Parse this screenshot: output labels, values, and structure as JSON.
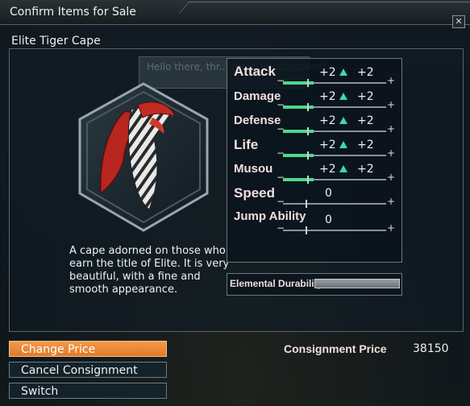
{
  "window": {
    "title": "Confirm Items for Sale",
    "close_label": "✕"
  },
  "item": {
    "name": "Elite Tiger Cape",
    "description": "A cape adorned on those who earn the title of Elite. It is very beautiful, with a fine and smooth appearance."
  },
  "background_dialog": {
    "text": "Hello there, thr... (partially obscured)"
  },
  "stats": [
    {
      "label": "Attack",
      "current": "+2",
      "new": "+2",
      "level": 0.3
    },
    {
      "label": "Damage",
      "current": "+2",
      "new": "+2",
      "level": 0.3
    },
    {
      "label": "Defense",
      "current": "+2",
      "new": "+2",
      "level": 0.3
    },
    {
      "label": "Life",
      "current": "+2",
      "new": "+2",
      "level": 0.3
    },
    {
      "label": "Musou",
      "current": "+2",
      "new": "+2",
      "level": 0.3
    },
    {
      "label": "Speed",
      "current": "0",
      "new": "",
      "level": 0.25
    },
    {
      "label": "Jump Ability",
      "current": "0",
      "new": "",
      "level": 0.25
    }
  ],
  "durability": {
    "label": "Elemental Durability",
    "level": 1.0
  },
  "buttons": {
    "change_price": "Change Price",
    "cancel_consignment": "Cancel Consignment",
    "switch": "Switch"
  },
  "price": {
    "label": "Consignment Price",
    "value": "38150"
  },
  "colors": {
    "accent": "#e88a3a",
    "stat_up": "#3fd6b2",
    "label": "#f3dede"
  }
}
